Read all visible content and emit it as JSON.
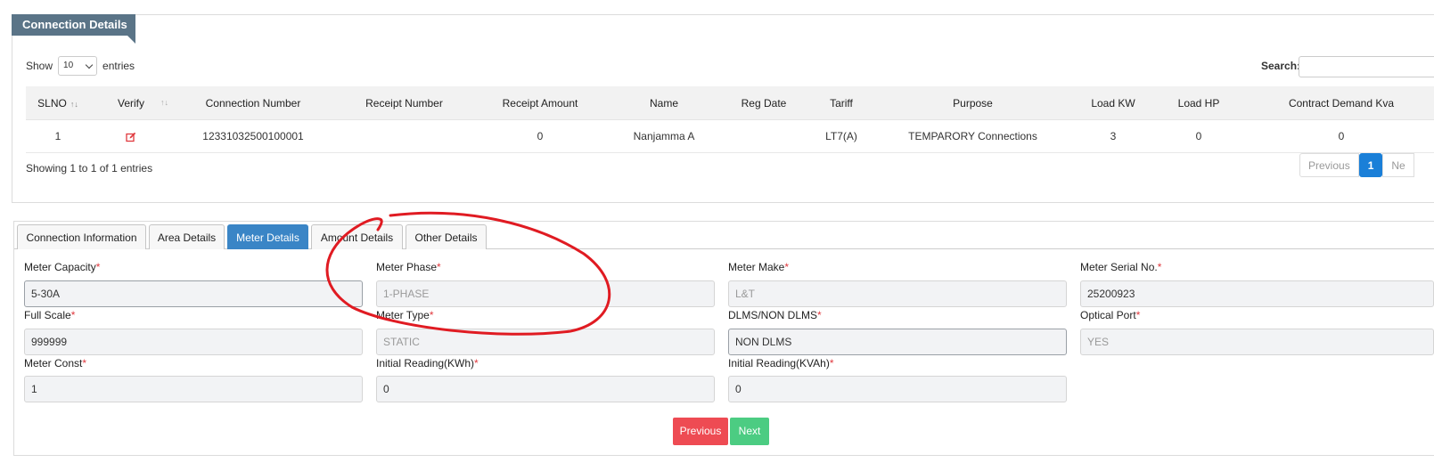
{
  "panel": {
    "title": "Connection Details"
  },
  "length_menu": {
    "show": "Show",
    "value": "10",
    "entries": "entries"
  },
  "search": {
    "label": "Search:"
  },
  "table": {
    "columns": [
      "SLNO",
      "Verify",
      "Connection Number",
      "Receipt Number",
      "Receipt Amount",
      "Name",
      "Reg Date",
      "Tariff",
      "Purpose",
      "Load KW",
      "Load HP",
      "Contract Demand Kva"
    ],
    "rows": [
      {
        "slno": "1",
        "verify_icon": "edit-icon",
        "connection_number": "12331032500100001",
        "receipt_number": "",
        "receipt_amount": "0",
        "name": "Nanjamma A",
        "reg_date": "",
        "tariff": "LT7(A)",
        "purpose": "TEMPARORY Connections",
        "load_kw": "3",
        "load_hp": "0",
        "contract_demand": "0"
      }
    ]
  },
  "info": "Showing 1 to 1 of 1 entries",
  "pagination": {
    "previous": "Previous",
    "current": "1",
    "next": "Ne"
  },
  "tabs": [
    "Connection Information",
    "Area Details",
    "Meter Details",
    "Amount Details",
    "Other Details"
  ],
  "active_tab": "Meter Details",
  "form": {
    "meter_capacity": {
      "label": "Meter Capacity",
      "value": "5-30A"
    },
    "meter_phase": {
      "label": "Meter Phase",
      "value": "1-PHASE"
    },
    "meter_make": {
      "label": "Meter Make",
      "value": "L&T"
    },
    "meter_serial": {
      "label": "Meter Serial No.",
      "value": "25200923"
    },
    "full_scale": {
      "label": "Full Scale",
      "value": "999999"
    },
    "meter_type": {
      "label": "Meter Type",
      "value": "STATIC"
    },
    "dlms": {
      "label": "DLMS/NON DLMS",
      "value": "NON DLMS"
    },
    "optical_port": {
      "label": "Optical Port",
      "value": "YES"
    },
    "meter_const": {
      "label": "Meter Const",
      "value": "1"
    },
    "initial_kwh": {
      "label": "Initial Reading(KWh)",
      "value": "0"
    },
    "initial_kvah": {
      "label": "Initial Reading(KVAh)",
      "value": "0"
    },
    "required_mark": "*"
  },
  "buttons": {
    "previous": "Previous",
    "next": "Next"
  },
  "colors": {
    "accent": "#3a85c6",
    "title_bar": "#5a7487",
    "prev_btn": "#ee4b53",
    "next_btn": "#4ccc82",
    "annotation": "#e01b22"
  }
}
